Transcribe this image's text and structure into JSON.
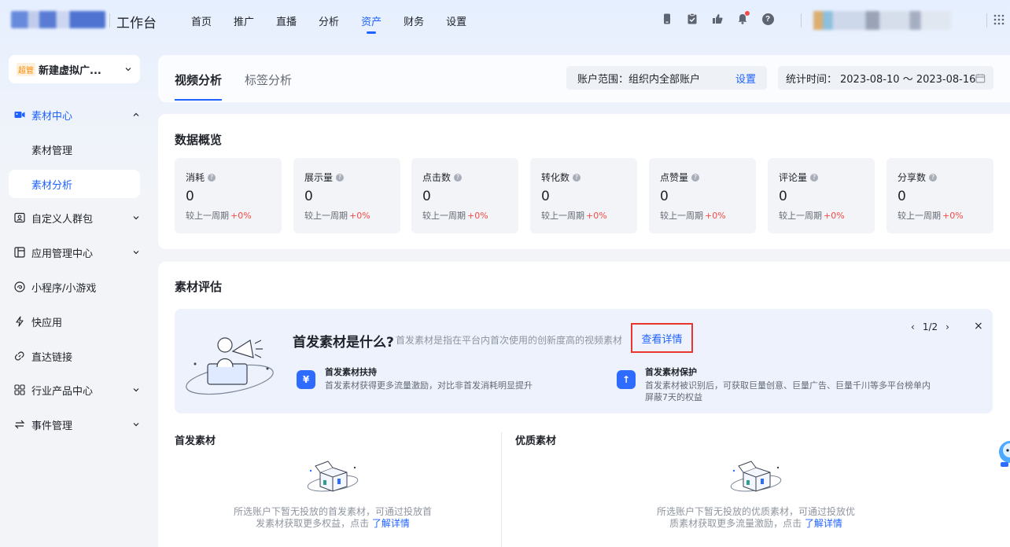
{
  "header": {
    "app_title": "工作台",
    "nav": [
      {
        "label": "首页",
        "active": false
      },
      {
        "label": "推广",
        "active": false
      },
      {
        "label": "直播",
        "active": false
      },
      {
        "label": "分析",
        "active": false
      },
      {
        "label": "资产",
        "active": true
      },
      {
        "label": "财务",
        "active": false
      },
      {
        "label": "设置",
        "active": false
      }
    ],
    "help_glyph": "?",
    "icons": [
      "device-icon",
      "clipboard-icon",
      "thumb-icon",
      "bell-icon",
      "help-icon",
      "app-grid-icon"
    ],
    "accent_color": "#1f62ff"
  },
  "sidebar": {
    "account": {
      "badge": "超管",
      "name": "新建虚拟广..."
    },
    "menu": {
      "material_center": "素材中心",
      "material_manage": "素材管理",
      "material_analysis": "素材分析",
      "custom_audience": "自定义人群包",
      "app_center": "应用管理中心",
      "mini_program": "小程序/小游戏",
      "quick_app": "快应用",
      "direct_link": "直达链接",
      "industry_product": "行业产品中心",
      "event_manage": "事件管理"
    }
  },
  "tabs": {
    "video": "视频分析",
    "tag": "标签分析",
    "scope_label": "账户范围：组织内全部账户",
    "scope_link": "设置",
    "date_label": "统计时间：",
    "date_range": "2023-08-10 ～ 2023-08-16"
  },
  "overview": {
    "title": "数据概览",
    "compare_label": "较上一周期",
    "info_glyph": "?",
    "metrics": [
      {
        "name": "消耗",
        "value": "0",
        "delta": "+0%"
      },
      {
        "name": "展示量",
        "value": "0",
        "delta": "+0%"
      },
      {
        "name": "点击数",
        "value": "0",
        "delta": "+0%"
      },
      {
        "name": "转化数",
        "value": "0",
        "delta": "+0%"
      },
      {
        "name": "点赞量",
        "value": "0",
        "delta": "+0%"
      },
      {
        "name": "评论量",
        "value": "0",
        "delta": "+0%"
      },
      {
        "name": "分享数",
        "value": "0",
        "delta": "+0%"
      }
    ]
  },
  "evaluation": {
    "title": "素材评估",
    "banner": {
      "title": "首发素材是什么?",
      "desc": "首发素材是指在平台内首次使用的创新度高的视频素材",
      "link": "查看详情",
      "pager": "1/2",
      "prev": "‹",
      "next": "›",
      "close": "×"
    },
    "features": [
      {
        "glyph": "¥",
        "title": "首发素材扶持",
        "desc": "首发素材获得更多流量激励，对比非首发消耗明显提升"
      },
      {
        "glyph": "↑",
        "title": "首发素材保护",
        "desc": "首发素材被识别后，可获取巨量创意、巨量广告、巨量千川等多平台榜单内",
        "desc2": "屏蔽7天的权益"
      }
    ],
    "first_col": {
      "title": "首发素材",
      "empty_line1": "所选账户下暂无投放的首发素材，可通过投放首",
      "empty_line2": "发素材获取更多权益，点击",
      "link": "了解详情"
    },
    "quality_col": {
      "title": "优质素材",
      "empty_line1": "所选账户下暂无投放的优质素材，可通过投放优",
      "empty_line2": "质素材获取更多流量激励，点击",
      "link": "了解详情"
    }
  }
}
